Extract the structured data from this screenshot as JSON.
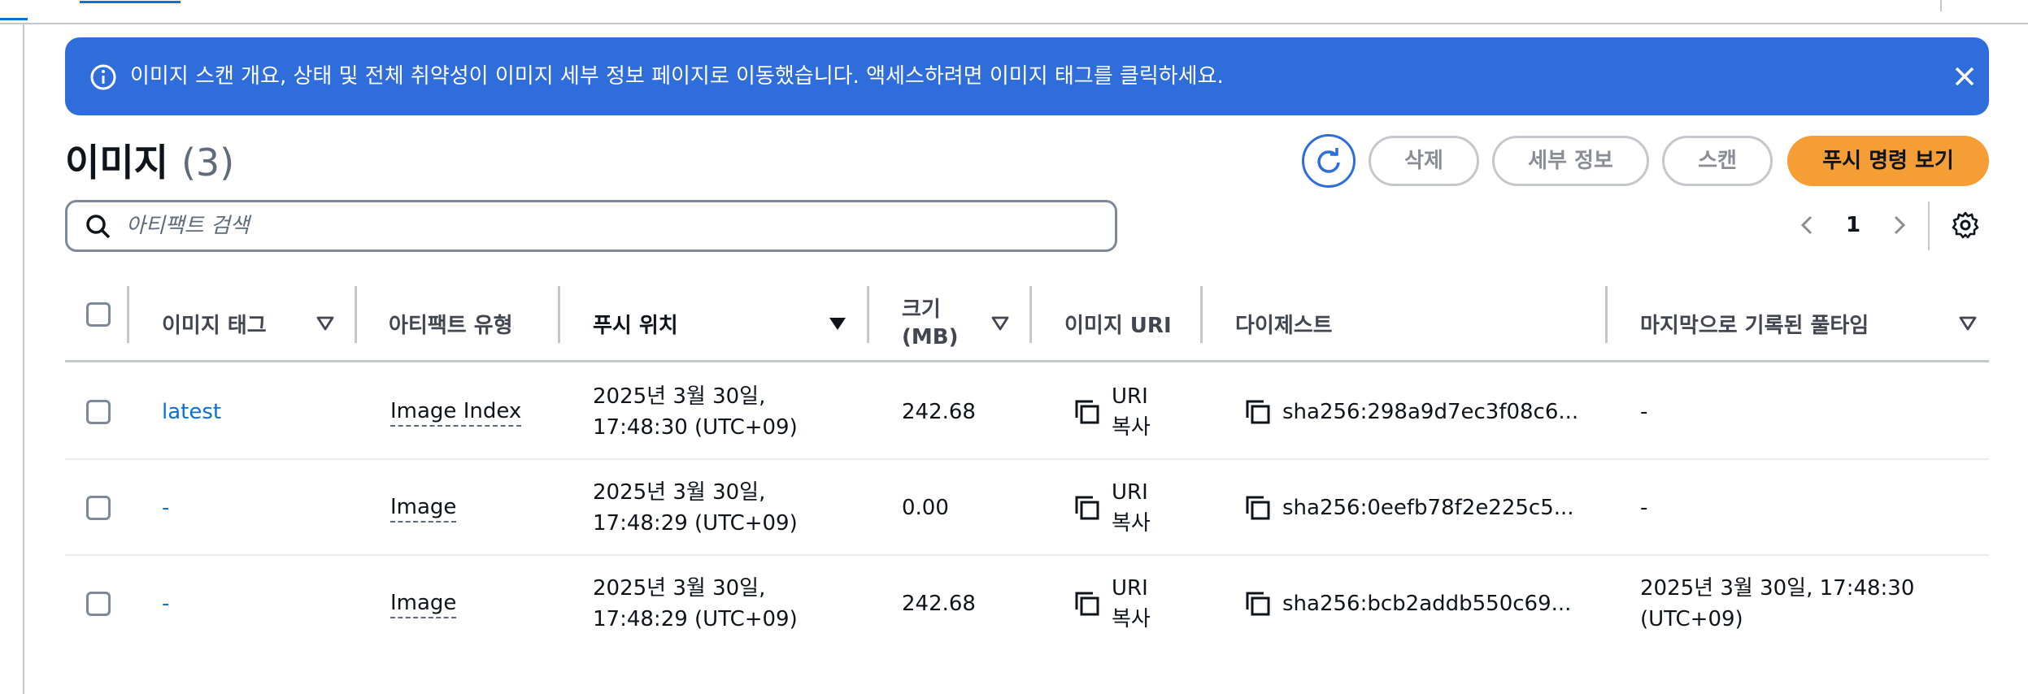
{
  "flash": {
    "message": "이미지 스캔 개요, 상태 및 전체 취약성이 이미지 세부 정보 페이지로 이동했습니다. 액세스하려면 이미지 태그를 클릭하세요."
  },
  "header": {
    "title": "이미지",
    "count": "(3)"
  },
  "actions": {
    "delete_label": "삭제",
    "details_label": "세부 정보",
    "scan_label": "스캔",
    "push_commands_label": "푸시 명령 보기"
  },
  "search": {
    "placeholder": "아티팩트 검색",
    "value": ""
  },
  "pagination": {
    "current_page": "1"
  },
  "table": {
    "columns": {
      "image_tag": "이미지 태그",
      "artifact_type": "아티팩트 유형",
      "pushed_at": "푸시 위치",
      "size_line1": "크기",
      "size_line2": "(MB)",
      "image_uri": "이미지 URI",
      "digest": "다이제스트",
      "last_pull": "마지막으로 기록된 풀타임"
    },
    "rows": [
      {
        "tag": "latest",
        "artifact_type": "Image Index",
        "pushed_line1": "2025년 3월 30일,",
        "pushed_line2": "17:48:30 (UTC+09)",
        "size": "242.68",
        "uri_line1": "URI",
        "uri_line2": "복사",
        "digest": "sha256:298a9d7ec3f08c6...",
        "last_pull_line1": "-",
        "last_pull_line2": ""
      },
      {
        "tag": "-",
        "artifact_type": "Image",
        "pushed_line1": "2025년 3월 30일,",
        "pushed_line2": "17:48:29 (UTC+09)",
        "size": "0.00",
        "uri_line1": "URI",
        "uri_line2": "복사",
        "digest": "sha256:0eefb78f2e225c5...",
        "last_pull_line1": "-",
        "last_pull_line2": ""
      },
      {
        "tag": "-",
        "artifact_type": "Image",
        "pushed_line1": "2025년 3월 30일,",
        "pushed_line2": "17:48:29 (UTC+09)",
        "size": "242.68",
        "uri_line1": "URI",
        "uri_line2": "복사",
        "digest": "sha256:bcb2addb550c69...",
        "last_pull_line1": "2025년 3월 30일, 17:48:30",
        "last_pull_line2": "(UTC+09)"
      }
    ]
  },
  "colors": {
    "flash_bg": "#2f6ddb",
    "primary_button": "#f59e35",
    "link": "#0972d3",
    "border": "#c6c6cd"
  }
}
